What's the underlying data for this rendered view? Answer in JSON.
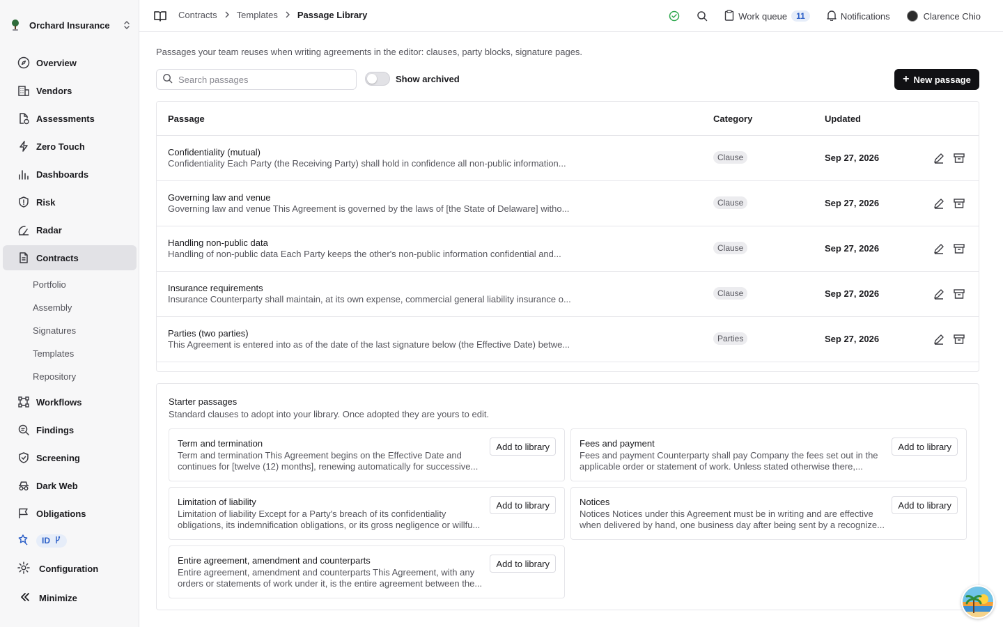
{
  "org": {
    "name": "Orchard Insurance"
  },
  "sidebar": {
    "items": [
      {
        "label": "Overview",
        "icon": "compass-icon"
      },
      {
        "label": "Vendors",
        "icon": "building-icon"
      },
      {
        "label": "Assessments",
        "icon": "file-check-icon"
      },
      {
        "label": "Zero Touch",
        "icon": "bolt-icon"
      },
      {
        "label": "Dashboards",
        "icon": "bar-chart-icon"
      },
      {
        "label": "Risk",
        "icon": "shield-icon"
      },
      {
        "label": "Radar",
        "icon": "radar-icon"
      },
      {
        "label": "Contracts",
        "icon": "document-icon"
      }
    ],
    "contracts_sub": [
      "Portfolio",
      "Assembly",
      "Signatures",
      "Templates",
      "Repository"
    ],
    "items_after": [
      {
        "label": "Workflows",
        "icon": "workflow-icon"
      },
      {
        "label": "Findings",
        "icon": "search-doc-icon"
      },
      {
        "label": "Screening",
        "icon": "shield-check-icon"
      },
      {
        "label": "Dark Web",
        "icon": "incognito-icon"
      },
      {
        "label": "Obligations",
        "icon": "flag-icon"
      }
    ],
    "id_badge": "ID",
    "configuration": "Configuration",
    "minimize": "Minimize"
  },
  "breadcrumbs": [
    "Contracts",
    "Templates",
    "Passage Library"
  ],
  "topbar": {
    "work_queue": "Work queue",
    "work_queue_count": "11",
    "notifications": "Notifications",
    "user": "Clarence Chio"
  },
  "intro": "Passages your team reuses when writing agreements in the editor: clauses, party blocks, signature pages.",
  "search": {
    "placeholder": "Search passages"
  },
  "show_archived": "Show archived",
  "new_passage": "New passage",
  "table": {
    "headers": {
      "passage": "Passage",
      "category": "Category",
      "updated": "Updated"
    },
    "rows": [
      {
        "title": "Confidentiality (mutual)",
        "snippet": "Confidentiality Each Party (the Receiving Party) shall hold in confidence all non-public information...",
        "category": "Clause",
        "updated": "Sep 27, 2026"
      },
      {
        "title": "Governing law and venue",
        "snippet": "Governing law and venue This Agreement is governed by the laws of [the State of Delaware] witho...",
        "category": "Clause",
        "updated": "Sep 27, 2026"
      },
      {
        "title": "Handling non-public data",
        "snippet": "Handling of non-public data Each Party keeps the other's non-public information confidential and...",
        "category": "Clause",
        "updated": "Sep 27, 2026"
      },
      {
        "title": "Insurance requirements",
        "snippet": "Insurance Counterparty shall maintain, at its own expense, commercial general liability insurance o...",
        "category": "Clause",
        "updated": "Sep 27, 2026"
      },
      {
        "title": "Parties (two parties)",
        "snippet": "This Agreement is entered into as of the date of the last signature below (the Effective Date) betwe...",
        "category": "Parties",
        "updated": "Sep 27, 2026"
      }
    ]
  },
  "starter": {
    "title": "Starter passages",
    "subtitle": "Standard clauses to adopt into your library. Once adopted they are yours to edit.",
    "add_label": "Add to library",
    "cards": [
      {
        "title": "Term and termination",
        "body": "Term and termination This Agreement begins on the Effective Date and continues for [twelve (12) months], renewing automatically for successive..."
      },
      {
        "title": "Fees and payment",
        "body": "Fees and payment Counterparty shall pay Company the fees set out in the applicable order or statement of work. Unless stated otherwise there,..."
      },
      {
        "title": "Limitation of liability",
        "body": "Limitation of liability Except for a Party's breach of its confidentiality obligations, its indemnification obligations, or its gross negligence or willfu..."
      },
      {
        "title": "Notices",
        "body": "Notices Notices under this Agreement must be in writing and are effective when delivered by hand, one business day after being sent by a recognize..."
      },
      {
        "title": "Entire agreement, amendment and counterparts",
        "body": "Entire agreement, amendment and counterparts This Agreement, with any orders or statements of work under it, is the entire agreement between the..."
      }
    ]
  },
  "colors": {
    "accent": "#2c5fc7",
    "primary_button": "#111114",
    "status_ok": "#2fa84f"
  }
}
